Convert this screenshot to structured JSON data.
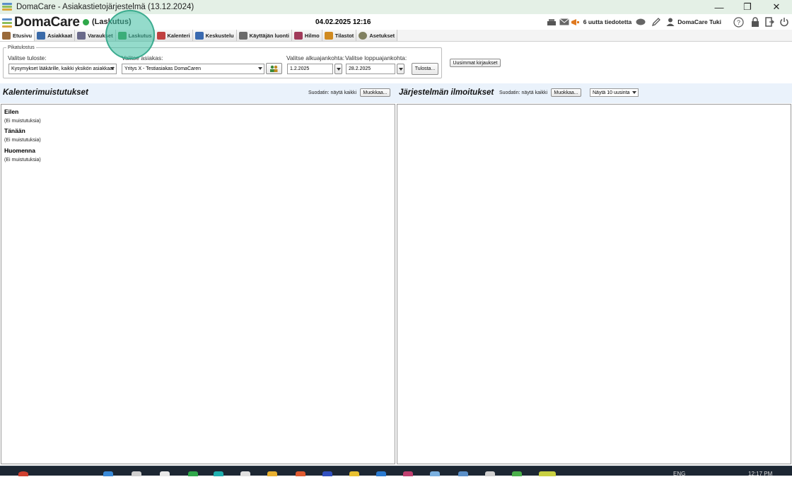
{
  "window": {
    "title": "DomaCare - Asiakastietojärjestelmä (13.12.2024)",
    "controls": {
      "minimize": "—",
      "restore": "❐",
      "close": "✕"
    }
  },
  "header": {
    "brand": "DomaCare",
    "status_label": "(Laskutus)",
    "datetime": "04.02.2025 12:16",
    "notifications": "6 uutta tiedotetta",
    "user": "DomaCare Tuki"
  },
  "nav": {
    "tabs": [
      {
        "label": "Etusivu",
        "icon": "home-icon",
        "color": "#7a5a3a"
      },
      {
        "label": "Asiakkaat",
        "icon": "people-icon",
        "color": "#3a6aa8"
      },
      {
        "label": "Varaukset",
        "icon": "building-icon",
        "color": "#6a6a8a"
      },
      {
        "label": "Laskutus",
        "icon": "piggy-bank-icon",
        "color": "#3a9a4a"
      },
      {
        "label": "Kalenteri",
        "icon": "calendar-icon",
        "color": "#c04040"
      },
      {
        "label": "Keskustelu",
        "icon": "chat-icon",
        "color": "#3a6ab0"
      },
      {
        "label": "Käyttäjän luonti",
        "icon": "user-add-icon",
        "color": "#6a6a6a"
      },
      {
        "label": "Hilmo",
        "icon": "hilmo-icon",
        "color": "#a03a5a"
      },
      {
        "label": "Tilastot",
        "icon": "chart-icon",
        "color": "#d08a20"
      },
      {
        "label": "Asetukset",
        "icon": "gear-icon",
        "color": "#808060"
      }
    ]
  },
  "quickprint": {
    "legend": "Pikatulostus",
    "report_label": "Valitse tuloste:",
    "report_value": "Kysymykset lääkärille, kaikki yksikön asiakkaat",
    "customer_label": "Valitse asiakas:",
    "customer_value": "Yritys X -  Testiasiakas DomaCaren",
    "start_label": "Valitse alkuajankohta:",
    "start_value": "1.2.2025",
    "end_label": "Valitse loppuajankohta:",
    "end_value": "28.2.2025",
    "print_button": "Tulosta...",
    "latest_button": "Uusimmat kirjaukset"
  },
  "calendar_panel": {
    "title": "Kalenterimuistutukset",
    "filter": "Suodatin: näytä kaikki",
    "edit_button": "Muokkaa...",
    "days": [
      {
        "title": "Eilen",
        "empty": "(Ei muistutuksia)"
      },
      {
        "title": "Tänään",
        "empty": "(Ei muistutuksia)"
      },
      {
        "title": "Huomenna",
        "empty": "(Ei muistutuksia)"
      }
    ]
  },
  "system_panel": {
    "title": "Järjestelmän ilmoitukset",
    "filter": "Suodatin: näytä kaikki",
    "edit_button": "Muokkaa...",
    "show_select": "Näytä 10 uusinta"
  },
  "taskbar": {
    "lang": "ENG",
    "time": "12:17 PM"
  }
}
